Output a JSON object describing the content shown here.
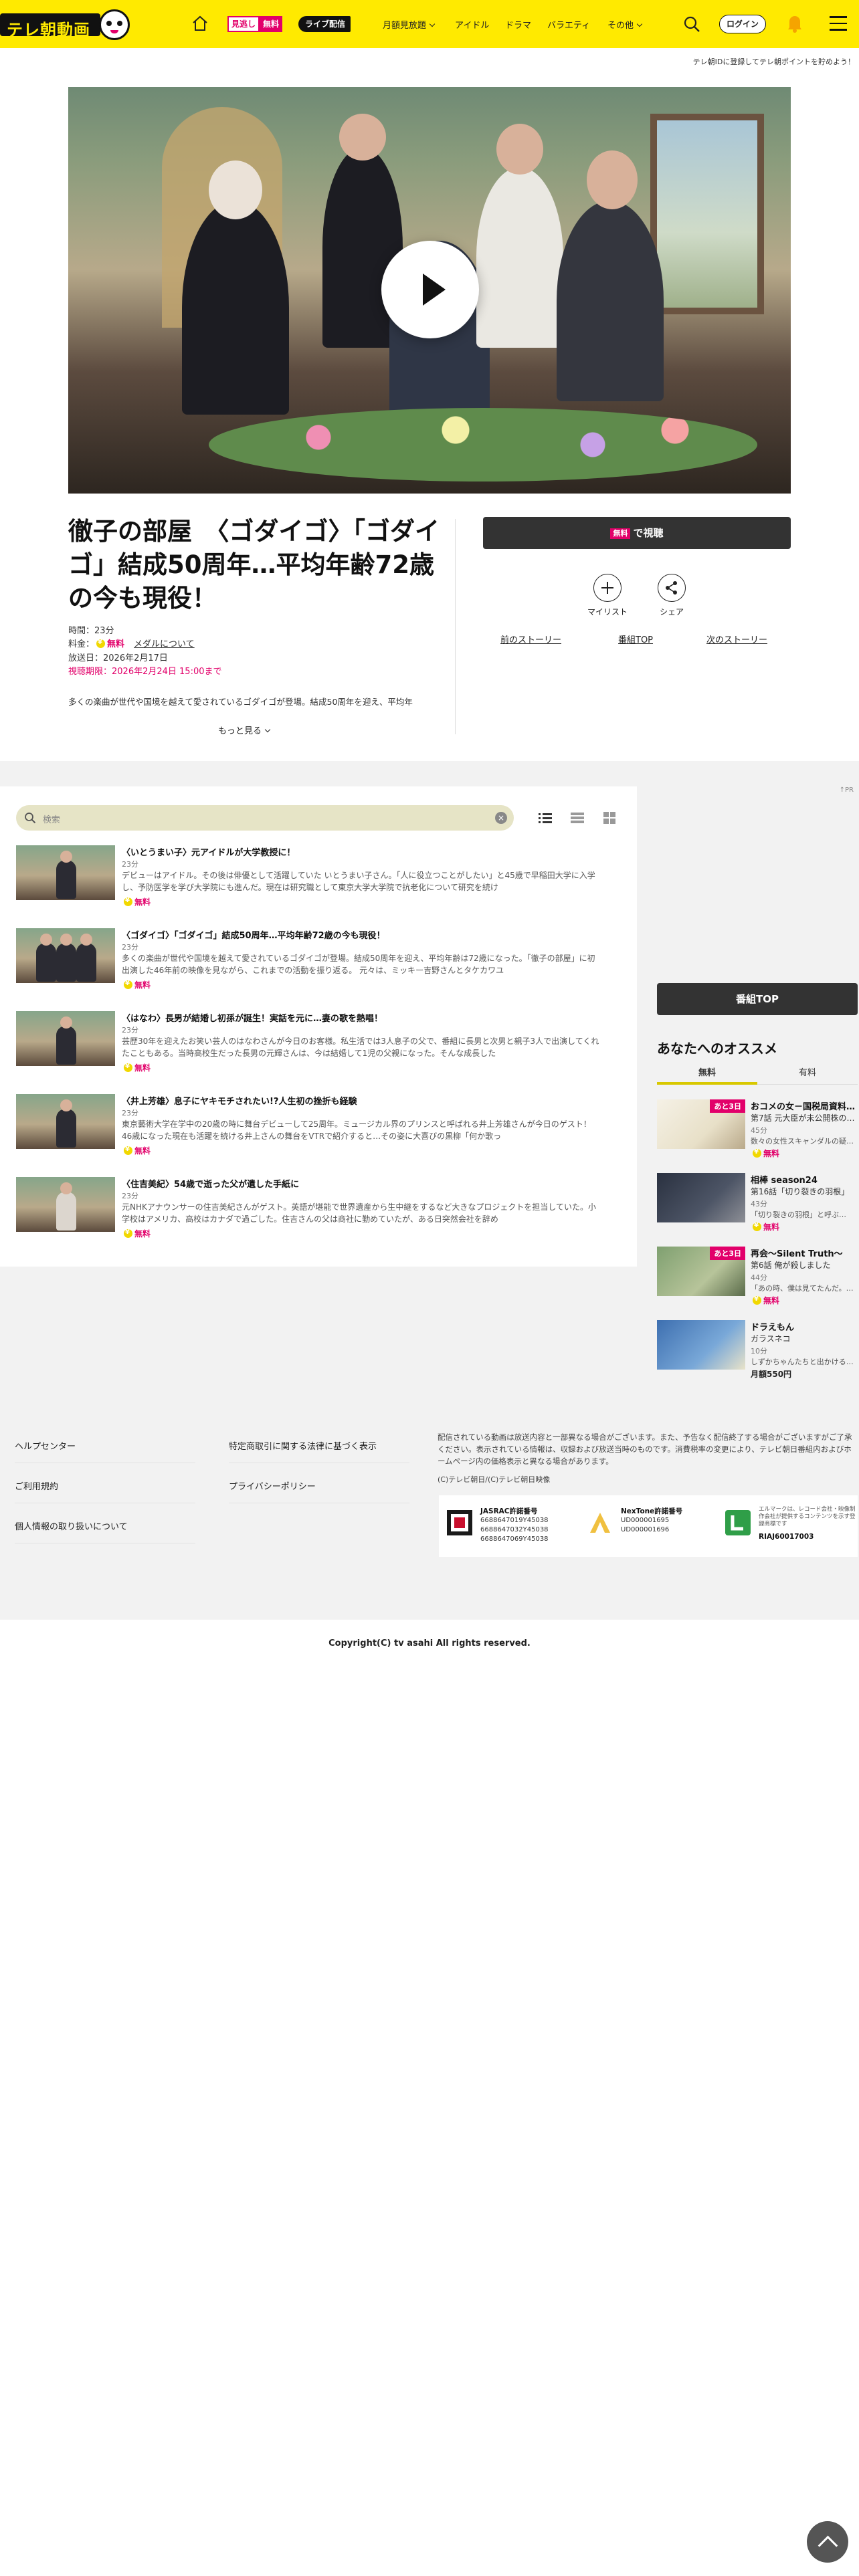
{
  "header": {
    "logo_text": "テレ朝動画",
    "mika_left": "見逃し",
    "mika_right": "無料",
    "live": "ライブ配信",
    "nav": [
      "月額見放題",
      "アイドル",
      "ドラマ",
      "バラエティ",
      "その他"
    ],
    "login": "ログイン",
    "banner": "テレ朝IDに登録してテレ朝ポイントを貯めよう！"
  },
  "episode": {
    "title": "徹子の部屋　〈ゴダイゴ〉「ゴダイゴ」結成50周年…平均年齢72歳の今も現役！",
    "duration": "時間：23分",
    "price_label": "料金：",
    "price": "無料",
    "media_link": "メダルについて",
    "air_date": "放送日：2026年2月17日",
    "deadline": "視聴期限：2026年2月24日 15:00まで",
    "description": "多くの楽曲が世代や国境を越えて愛されているゴダイゴが登場。結成50周年を迎え、平均年",
    "more": "もっと見る"
  },
  "actions": {
    "watch_badge": "無料",
    "watch": "で視聴",
    "mylist": "マイリスト",
    "share": "シェア",
    "prev": "前のストーリー",
    "top": "番組TOP",
    "next": "次のストーリー"
  },
  "list": {
    "ad_mark": "↑PR",
    "search_placeholder": "検索",
    "clear": "×",
    "episodes": [
      {
        "title": "〈いとうまい子〉元アイドルが大学教授に！",
        "duration": "23分",
        "summary": "デビューはアイドル。その後は俳優として活躍していた いとうまい子さん。「人に役立つことがしたい」と45歳で早稲田大学に入学し、予防医学を学び大学院にも進んだ。現在は研究職として東京大学大学院で抗老化について研究を続け",
        "free": "無料"
      },
      {
        "title": "〈ゴダイゴ〉「ゴダイゴ」結成50周年…平均年齢72歳の今も現役！",
        "duration": "23分",
        "summary": "多くの楽曲が世代や国境を越えて愛されているゴダイゴが登場。結成50周年を迎え、平均年齢は72歳になった。「徹子の部屋」に初出演した46年前の映像を見ながら、これまでの活動を振り返る。 元々は、ミッキー吉野さんとタケカワユ",
        "free": "無料"
      },
      {
        "title": "〈はなわ〉長男が結婚し初孫が誕生！実話を元に…妻の歌を熱唱！",
        "duration": "23分",
        "summary": "芸歴30年を迎えたお笑い芸人のはなわさんが今日のお客様。私生活では3人息子の父で、番組に長男と次男と親子3人で出演してくれたこともある。当時高校生だった長男の元輝さんは、今は結婚して1児の父親になった。そんな成長した",
        "free": "無料"
      },
      {
        "title": "〈井上芳雄〉息子にヤキモチされたい!?人生初の挫折も経験",
        "duration": "23分",
        "summary": "東京藝術大学在学中の20歳の時に舞台デビューして25周年。ミュージカル界のプリンスと呼ばれる井上芳雄さんが今日のゲスト！46歳になった現在も活躍を続ける井上さんの舞台をVTRで紹介すると…その姿に大喜びの黒柳「何か歌っ",
        "free": "無料"
      },
      {
        "title": "〈住吉美紀〉54歳で逝った父が遺した手紙に",
        "duration": "23分",
        "summary": "元NHKアナウンサーの住吉美紀さんがゲスト。英語が堪能で世界遺産から生中継をするなど大きなプロジェクトを担当していた。小学校はアメリカ、高校はカナダで過ごした。住吉さんの父は商社に勤めていたが、ある日突然会社を辞め",
        "free": "無料"
      }
    ]
  },
  "sidebar": {
    "bangumi_top": "番組TOP",
    "reco_title": "あなたへのオススメ",
    "tabs": [
      "無料",
      "有料"
    ],
    "items": [
      {
        "tag": "あと3日",
        "title": "おコメの女－国税局資料…",
        "sub": "第7話 元大臣が未公開株の…",
        "duration": "45分",
        "desc": "数々の女性スキャンダルの疑…",
        "price": "無料"
      },
      {
        "tag": "",
        "title": "相棒 season24",
        "sub": "第16話「切り裂きの羽根」",
        "duration": "43分",
        "desc": "「切り裂きの羽根」と呼ぶ…",
        "price": "無料"
      },
      {
        "tag": "あと3日",
        "title": "再会～Silent Truth～",
        "sub": "第6話 俺が殺しました",
        "duration": "44分",
        "desc": "「あの時、僕は見てたんだ。…",
        "price": "無料"
      },
      {
        "tag": "",
        "title": "ドラえもん",
        "sub": "ガラスネコ",
        "duration": "10分",
        "desc": "しずかちゃんたちと出かける…",
        "price": "月額550円"
      }
    ]
  },
  "footer": {
    "links": [
      "ヘルプセンター",
      "特定商取引に関する法律に基づく表示",
      "ご利用規約",
      "プライバシーポリシー",
      "個人情報の取り扱いについて"
    ],
    "note": "配信されている動画は放送内容と一部異なる場合がございます。また、予告なく配信終了する場合がございますがご了承ください。表示されている情報は、収録および放送当時のものです。消費税率の変更により、テレビ朝日番組内およびホームページ内の価格表示と異なる場合があります。",
    "copy_small": "(C)テレビ朝日/(C)テレビ朝日映像",
    "jasrac_title": "JASRAC許諾番号",
    "jasrac": [
      "6688647019Y45038",
      "6688647032Y45038",
      "6688647069Y45038"
    ],
    "nextone_title": "NexTone許諾番号",
    "nextone": [
      "UD000001695",
      "UD000001696"
    ],
    "riaj_text": "エルマークは、レコード会社・映像制作会社が提供するコンテンツを示す登録商標です",
    "riaj": "RIAJ60017003",
    "copyright": "Copyright(C) tv asahi All rights reserved."
  }
}
